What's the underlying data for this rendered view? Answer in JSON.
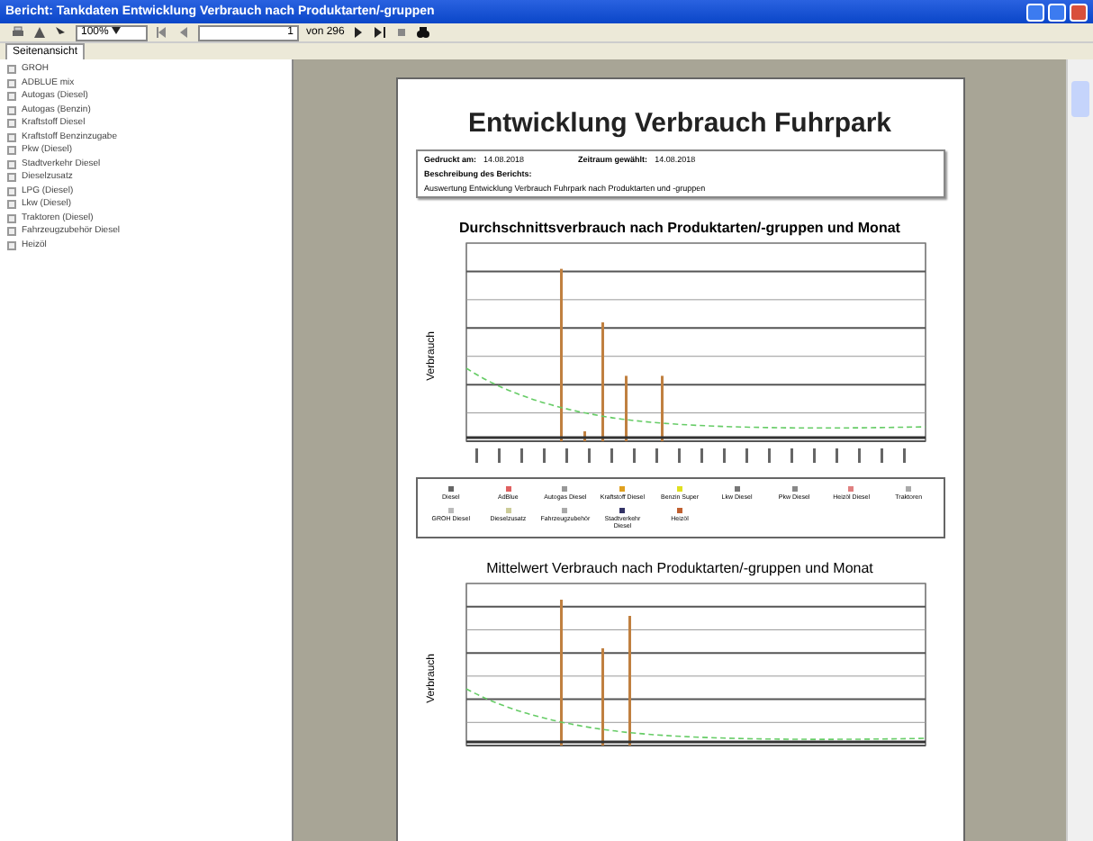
{
  "window": {
    "title": "Bericht: Tankdaten Entwicklung Verbrauch nach Produktarten/-gruppen"
  },
  "toolbar": {
    "zoom": "100%",
    "page": "1",
    "page_total": "von 296"
  },
  "tabs": [
    {
      "label": "Seitenansicht",
      "selected": true
    }
  ],
  "sidebar": {
    "items": [
      {
        "label": "GROH",
        "expanded": false
      },
      {
        "label": "ADBLUE mix",
        "expanded": false
      },
      {
        "label": "Autogas (Diesel)",
        "expanded": false
      },
      {
        "label": "Autogas (Benzin)",
        "expanded": false
      },
      {
        "label": "Kraftstoff Diesel",
        "expanded": false
      },
      {
        "label": "Kraftstoff Benzinzugabe",
        "expanded": false
      },
      {
        "label": "Pkw (Diesel)",
        "expanded": false
      },
      {
        "label": "Stadtverkehr Diesel",
        "expanded": false
      },
      {
        "label": "Dieselzusatz",
        "expanded": false
      },
      {
        "label": "LPG (Diesel)",
        "expanded": false
      },
      {
        "label": "Lkw (Diesel)",
        "expanded": false
      },
      {
        "label": "Traktoren (Diesel)",
        "expanded": false
      },
      {
        "label": "Fahrzeugzubehör Diesel",
        "expanded": false
      },
      {
        "label": "Heizöl",
        "expanded": false
      }
    ]
  },
  "report": {
    "title": "Entwicklung Verbrauch Fuhrpark",
    "info": [
      {
        "label": "Gedruckt am:",
        "value": "14.08.2018"
      },
      {
        "label": "Zeitraum gewählt:",
        "value": "14.08.2018"
      }
    ],
    "description_label": "Beschreibung des Berichts:",
    "description": "Auswertung Entwicklung Verbrauch Fuhrpark nach Produktarten und -gruppen",
    "charts": [
      {
        "title": "Durchschnittsverbrauch nach Produktarten/-gruppen und Monat",
        "ylabel": "Verbrauch",
        "legend": [
          {
            "label": "Diesel",
            "color": "#666666"
          },
          {
            "label": "AdBlue",
            "color": "#e06060"
          },
          {
            "label": "Autogas Diesel",
            "color": "#999999"
          },
          {
            "label": "Kraftstoff Diesel",
            "color": "#e0a020"
          },
          {
            "label": "Benzin Super",
            "color": "#e0e020"
          },
          {
            "label": "Lkw Diesel",
            "color": "#777777"
          },
          {
            "label": "Pkw Diesel",
            "color": "#888888"
          },
          {
            "label": "Heizöl Diesel",
            "color": "#e08080"
          },
          {
            "label": "Traktoren",
            "color": "#aaaaaa"
          },
          {
            "label": "GROH Diesel",
            "color": "#bbbbbb"
          },
          {
            "label": "Dieselzusatz",
            "color": "#cccc99"
          },
          {
            "label": "Fahrzeugzubehör",
            "color": "#aaaaaa"
          },
          {
            "label": "Stadtverkehr Diesel",
            "color": "#333366"
          },
          {
            "label": "Heizöl",
            "color": "#c06030"
          }
        ]
      },
      {
        "title": "Mittelwert Verbrauch nach Produktarten/-gruppen und Monat",
        "ylabel": "Verbrauch"
      }
    ]
  }
}
